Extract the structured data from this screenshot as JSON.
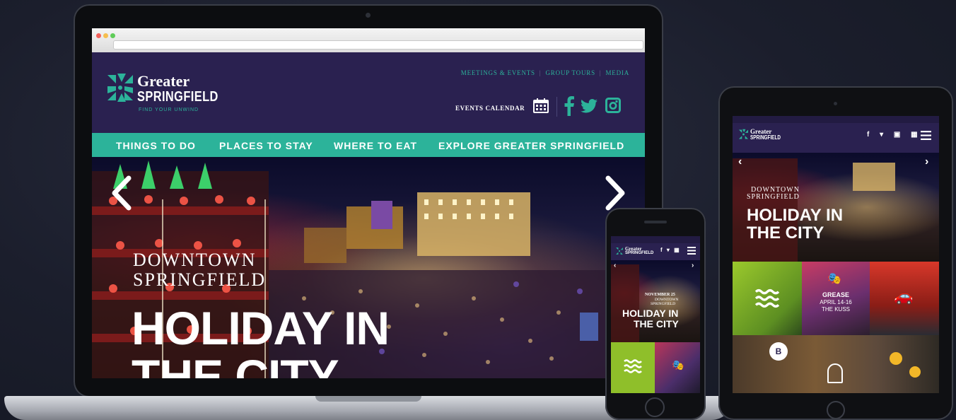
{
  "colors": {
    "brand_purple": "#2a2150",
    "brand_teal": "#2cb39a",
    "white": "#ffffff"
  },
  "site": {
    "logo": {
      "line1": "Greater",
      "line2": "SPRINGFIELD",
      "tagline": "FIND YOUR UNWIND"
    },
    "top_links": [
      "MEETINGS & EVENTS",
      "GROUP TOURS",
      "MEDIA"
    ],
    "top_links_separator": "|",
    "events_calendar_label": "EVENTS CALENDAR",
    "icons": {
      "calendar": "calendar-icon",
      "facebook": "facebook-icon",
      "twitter": "twitter-icon",
      "instagram": "instagram-icon",
      "menu": "menu-icon"
    },
    "nav": [
      "THINGS TO DO",
      "PLACES TO STAY",
      "WHERE TO EAT",
      "EXPLORE GREATER SPRINGFIELD"
    ],
    "hero": {
      "kicker_line1": "DOWNTOWN",
      "kicker_line2": "SPRINGFIELD",
      "title_line1": "HOLIDAY IN",
      "title_line2": "THE CITY",
      "prev_glyph": "‹",
      "next_glyph": "›"
    }
  },
  "phone": {
    "hero_date": "NOVEMBER 25",
    "hero_kicker_line1": "DOWNTOWN",
    "hero_kicker_line2": "SPRINGFIELD",
    "hero_title_line1": "HOLIDAY IN",
    "hero_title_line2": "THE CITY"
  },
  "tablet": {
    "tile_event_title": "GREASE",
    "tile_event_date": "APRIL 14-16",
    "tile_event_venue": "THE KUSS"
  }
}
